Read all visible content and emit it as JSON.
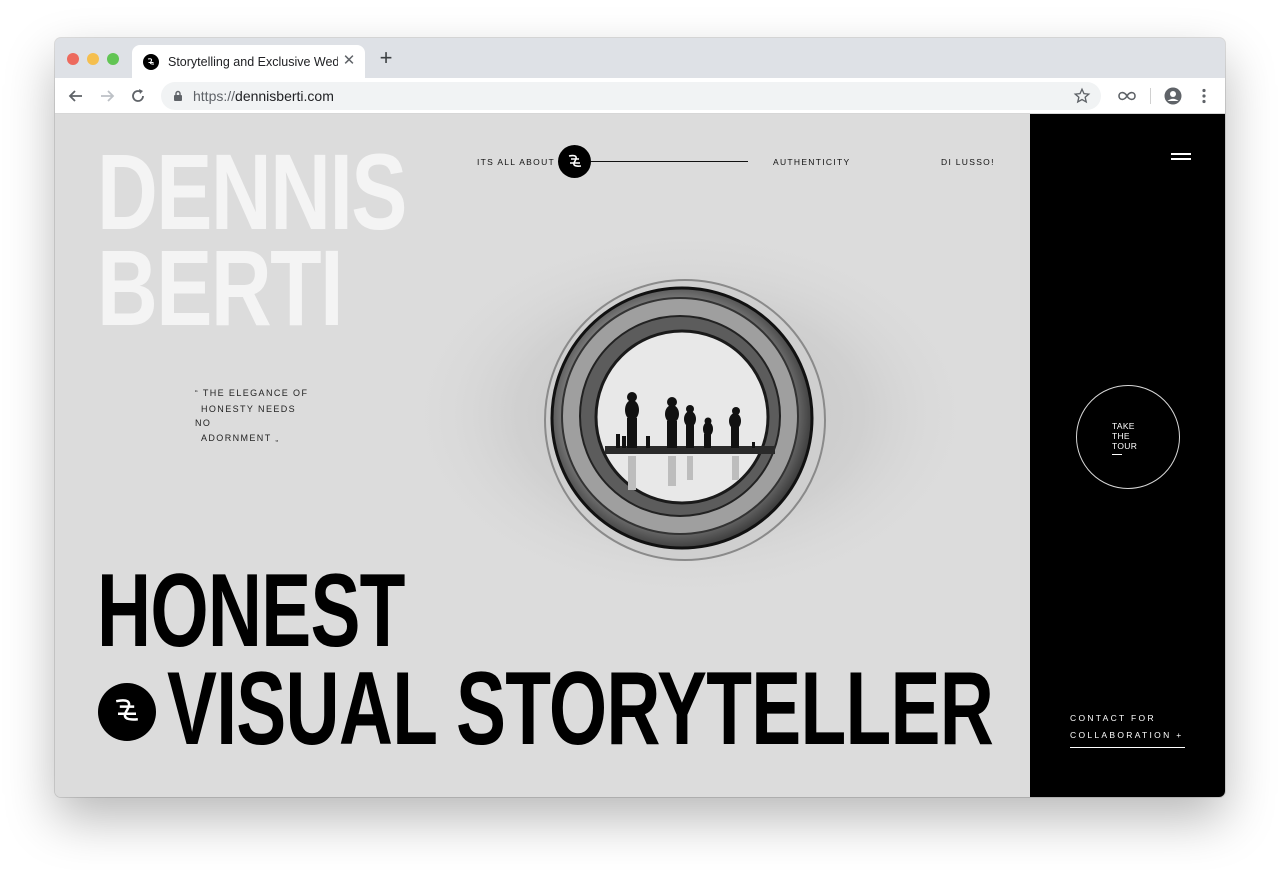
{
  "browser": {
    "tab_title": "Storytelling and Exclusive Wed",
    "url_scheme": "https://",
    "url_host": "dennisberti.com"
  },
  "hero": {
    "name_line1": "DENNIS",
    "name_line2": "BERTI",
    "quote_open": "“",
    "quote_lines": [
      "THE ELEGANCE OF",
      "HONESTY NEEDS NO",
      "ADORNMENT"
    ],
    "quote_close": "„",
    "nav_left": "ITS ALL ABOUT",
    "nav_mid": "AUTHENTICITY",
    "nav_right": "DI LUSSO!",
    "headline_line1": "HONEST",
    "headline_line2": "VISUAL STORYTELLER"
  },
  "side": {
    "tour_lines": [
      "TAKE",
      "THE",
      "TOUR"
    ],
    "contact_line1": "CONTACT FOR",
    "contact_line2": "COLLABORATION +"
  },
  "colors": {
    "page_bg": "#dcdcdc",
    "side_panel": "#000000",
    "name_text": "#f4f4f4",
    "headline_text": "#000000"
  },
  "icons": [
    "back-arrow-icon",
    "forward-arrow-icon",
    "reload-icon",
    "lock-icon",
    "star-icon",
    "infinity-icon",
    "account-icon",
    "more-icon",
    "hamburger-menu-icon",
    "logo-icon"
  ]
}
